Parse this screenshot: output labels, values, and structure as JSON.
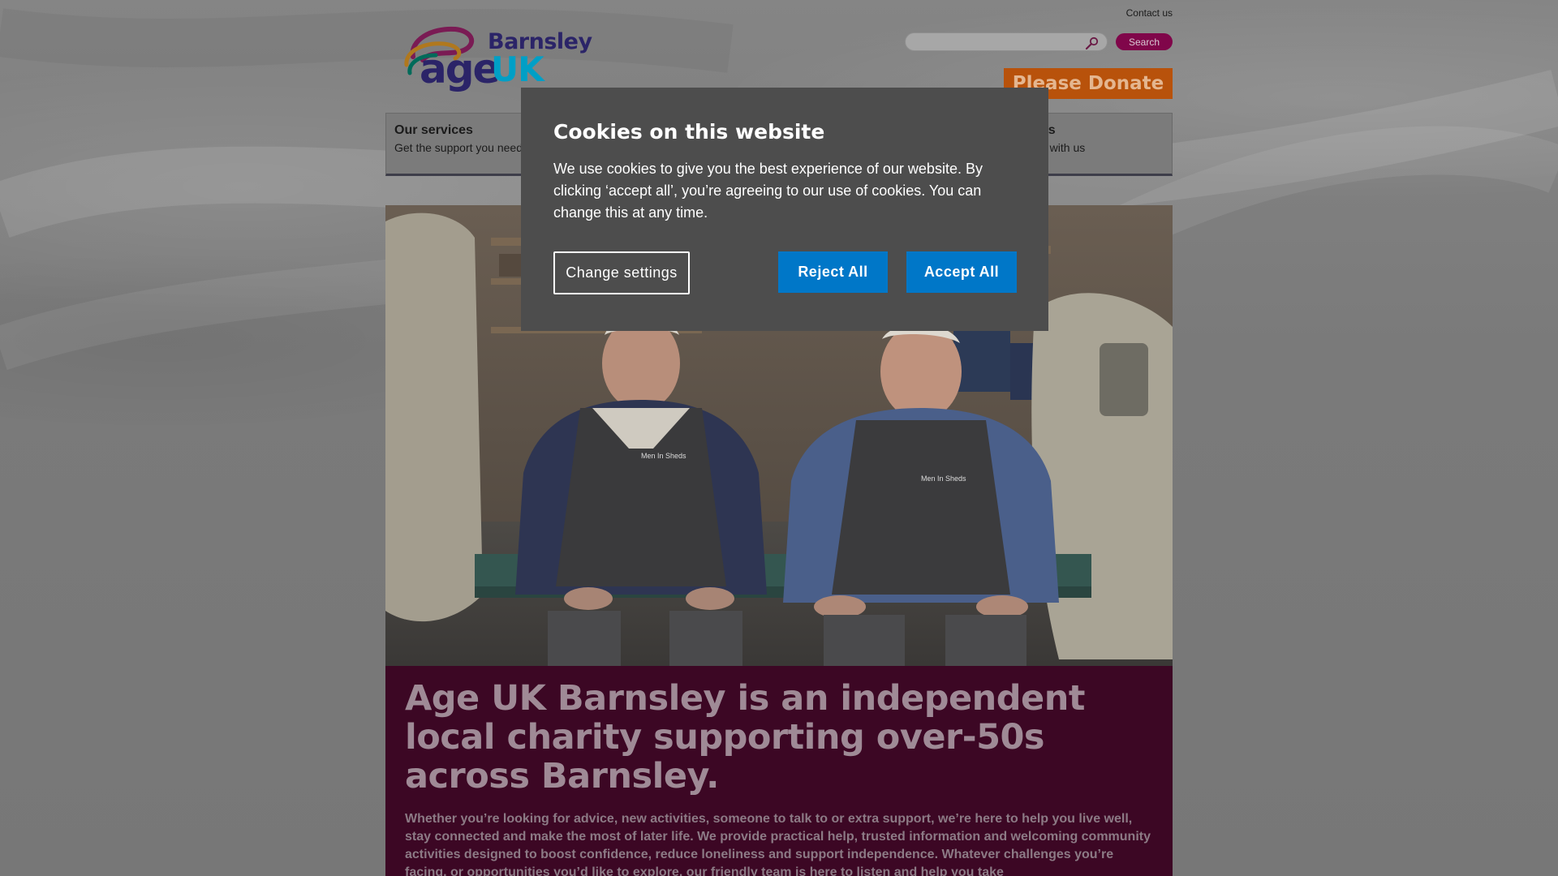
{
  "header": {
    "contact_label": "Contact us",
    "logo": {
      "line1": "Barnsley",
      "line2_a": "age",
      "line2_b": "UK"
    },
    "search": {
      "placeholder": "",
      "button_label": "Search",
      "icon": "search-icon"
    },
    "donate_label": "Please Donate"
  },
  "nav": {
    "items": [
      {
        "title": "Our services",
        "subtitle": "Get the support you need"
      },
      {
        "title": "ps",
        "subtitle": "p with us"
      }
    ]
  },
  "hero": {
    "apron_text_left": "Men In Sheds",
    "apron_text_right": "Men In Sheds"
  },
  "intro": {
    "heading": "Age UK Barnsley is an independent local charity supporting over-50s across Barnsley.",
    "body": "Whether you’re looking for advice, new activities, someone to talk to or extra support, we’re here to help you live well, stay connected and make the most of later life. We provide practical help, trusted information and welcoming community activities designed to boost confidence, reduce loneliness and support independence. Whatever challenges you’re facing, or opportunities you’d like to explore, our friendly team is here to listen and help you take"
  },
  "cookie": {
    "title": "Cookies on this website",
    "text": "We use cookies to give you the best experience of our website. By clicking ‘accept all’, you’re agreeing to our use of cookies. You can change this at any time.",
    "change_settings": "Change settings",
    "reject_all": "Reject All",
    "accept_all": "Accept All"
  },
  "colors": {
    "brand_purple": "#80064a",
    "brand_navy": "#2b2468",
    "brand_cyan": "#009fc6",
    "donate_orange": "#e36f14",
    "cookie_button_blue": "#0077c8"
  }
}
